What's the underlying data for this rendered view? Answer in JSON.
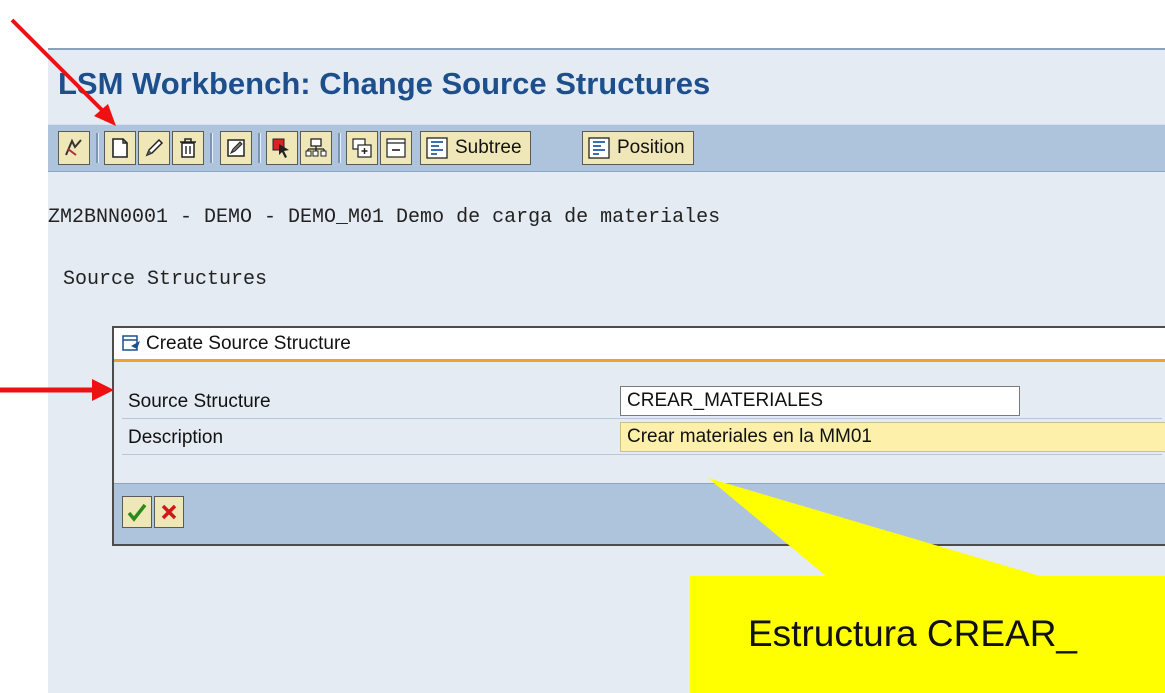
{
  "window": {
    "title": "LSM Workbench: Change Source Structures"
  },
  "toolbar": {
    "subtree_label": "Subtree",
    "position_label": "Position",
    "icons": [
      "other-object-icon",
      "create-icon",
      "change-icon",
      "delete-icon",
      "edit-description-icon",
      "select-icon",
      "select-block-icon",
      "expand-icon",
      "collapse-icon"
    ]
  },
  "context": {
    "project_line": "ZM2BNN0001 - DEMO - DEMO_M01 Demo de carga de materiales",
    "section_heading": "Source Structures"
  },
  "dialog": {
    "title": "Create Source Structure",
    "fields": [
      {
        "label": "Source Structure",
        "value": "CREAR_MATERIALES"
      },
      {
        "label": "Description",
        "value": "Crear materiales en la MM01"
      }
    ],
    "confirm_icon": "checkmark-icon",
    "cancel_icon": "cancel-x-icon"
  },
  "annotation": {
    "callout_text": "Estructura CREAR_",
    "callout_color": "#ffff00",
    "arrow_color": "#ee1111"
  },
  "colors": {
    "title_blue": "#1d4f8c",
    "toolbar_blue": "#aec4dd",
    "button_yellow": "#f0e7b8",
    "field_yellow": "#fdf0aa",
    "dialog_accent": "#f0a32a"
  }
}
